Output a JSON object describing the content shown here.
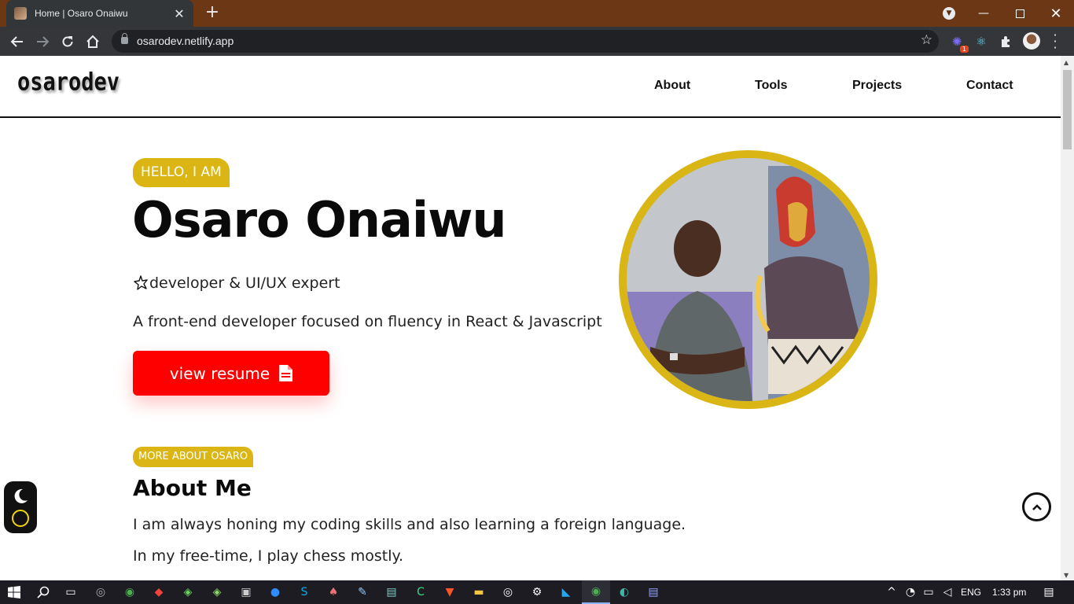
{
  "browser": {
    "tab_title": "Home | Osaro Onaiwu",
    "tab_close": "✕",
    "new_tab": "+",
    "url": "osarodev.netlify.app",
    "extension_badge": "1"
  },
  "site": {
    "logo": "osarodev",
    "nav": [
      "About",
      "Tools",
      "Projects",
      "Contact"
    ]
  },
  "hero": {
    "greeting": "HELLO, I AM",
    "name": "Osaro Onaiwu",
    "tagline": "developer & UI/UX expert",
    "intro": "A front-end developer focused on fluency in React & Javascript",
    "resume_button": "view resume"
  },
  "about": {
    "badge": "MORE ABOUT OSARO",
    "title": "About Me",
    "paragraphs": [
      "I am always honing my coding skills and also learning a foreign language.",
      "In my free-time, I play chess mostly."
    ]
  },
  "taskbar": {
    "language": "ENG",
    "time": "1:33 pm"
  },
  "colors": {
    "accent_gold": "#dbb514",
    "resume_red": "#ff0000",
    "tabbar_brown": "#6b3714"
  },
  "icons": {
    "taskbar": [
      "windows-icon",
      "search-icon",
      "task-view-icon",
      "obs-icon",
      "chrome-icon",
      "anydesk-icon",
      "git-icon",
      "git-kraken-icon",
      "terminal-icon",
      "zoom-icon",
      "skype-icon",
      "games-icon",
      "tools-icon",
      "notepad-icon",
      "camtasia-icon",
      "brave-icon",
      "file-explorer-icon",
      "target-icon",
      "settings-icon",
      "vscode-icon",
      "chrome-active-icon",
      "edge-icon",
      "document-icon"
    ]
  }
}
